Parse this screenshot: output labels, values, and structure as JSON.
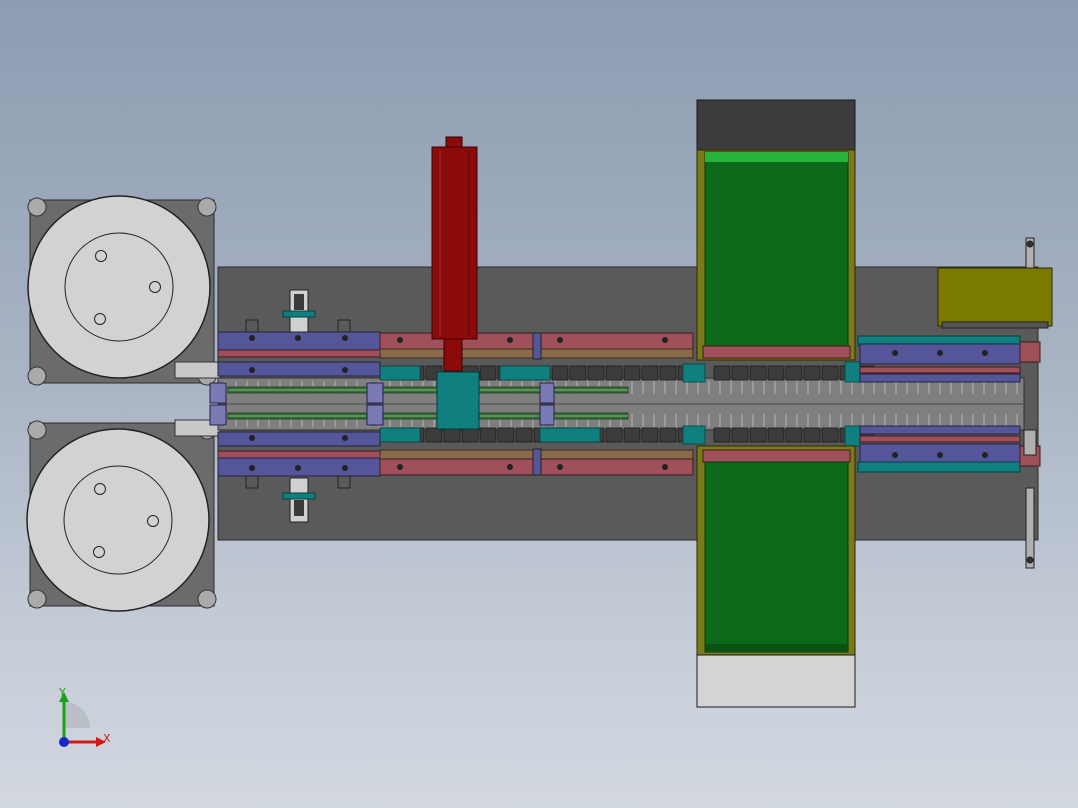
{
  "viewport": {
    "background_top": "#8c9cb1",
    "background_bottom": "#d3d8e0"
  },
  "model": {
    "colors": {
      "base_plate": "#5a5a5a",
      "reel_housing": "#6b6b6b",
      "reel_disc": "#d2d2d2",
      "rail_purple": "#555599",
      "rail_red": "#a0505a",
      "conveyor_green": "#0c6a1a",
      "conveyor_frame": "#7a7a1a",
      "cylinder_red": "#8b0b0b",
      "teal_block": "#0f7f80",
      "yellow_box": "#7a7a00",
      "channel_gray": "#808080",
      "slot_dark": "#3c3c3c"
    }
  },
  "triad": {
    "x_label": "X",
    "y_label": "Y",
    "x_color": "#d21818",
    "y_color": "#1aa01a",
    "z_color": "#1a28c8"
  }
}
